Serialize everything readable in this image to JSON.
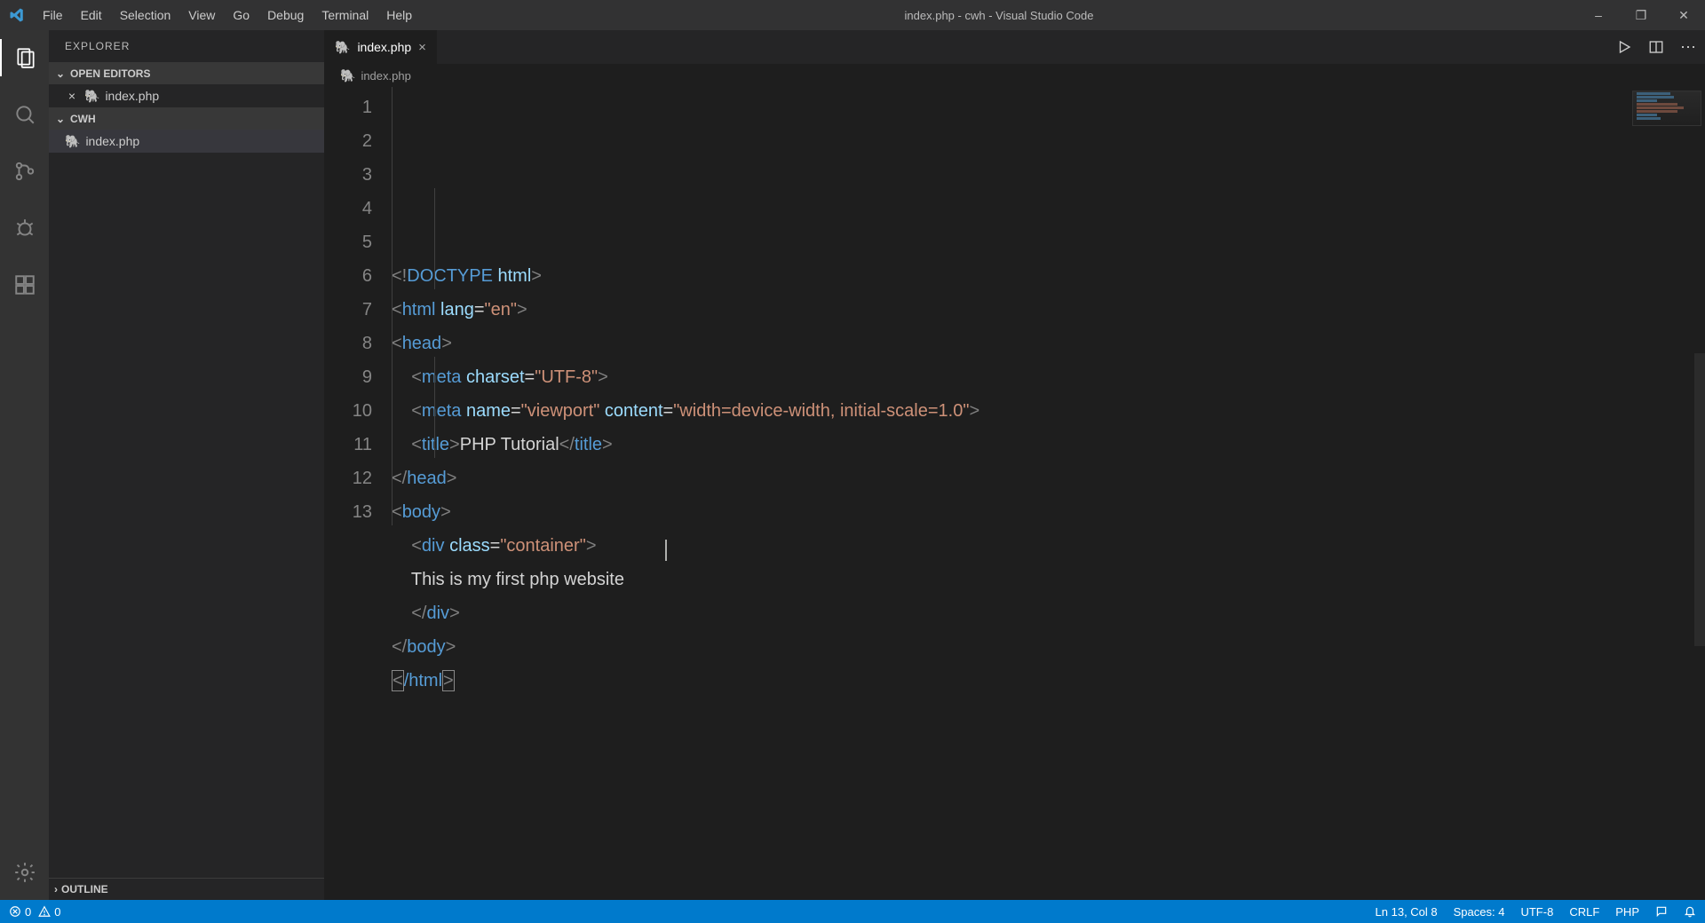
{
  "window": {
    "title": "index.php - cwh - Visual Studio Code"
  },
  "menus": [
    "File",
    "Edit",
    "Selection",
    "View",
    "Go",
    "Debug",
    "Terminal",
    "Help"
  ],
  "explorer": {
    "title": "EXPLORER",
    "open_editors_label": "OPEN EDITORS",
    "open_editors": [
      {
        "name": "index.php"
      }
    ],
    "folder_label": "CWH",
    "files": [
      {
        "name": "index.php"
      }
    ],
    "outline_label": "OUTLINE"
  },
  "tab": {
    "name": "index.php"
  },
  "breadcrumb": {
    "file": "index.php"
  },
  "code_lines": [
    {
      "n": "1",
      "tokens": [
        {
          "t": "<!",
          "c": "t-pun"
        },
        {
          "t": "DOCTYPE",
          "c": "t-doctype"
        },
        {
          "t": " ",
          "c": "t-txt"
        },
        {
          "t": "html",
          "c": "t-attr"
        },
        {
          "t": ">",
          "c": "t-pun"
        }
      ]
    },
    {
      "n": "2",
      "tokens": [
        {
          "t": "<",
          "c": "t-pun"
        },
        {
          "t": "html",
          "c": "t-tag"
        },
        {
          "t": " ",
          "c": ""
        },
        {
          "t": "lang",
          "c": "t-attr"
        },
        {
          "t": "=",
          "c": "t-txt"
        },
        {
          "t": "\"en\"",
          "c": "t-str"
        },
        {
          "t": ">",
          "c": "t-pun"
        }
      ]
    },
    {
      "n": "3",
      "tokens": [
        {
          "t": "<",
          "c": "t-pun"
        },
        {
          "t": "head",
          "c": "t-tag"
        },
        {
          "t": ">",
          "c": "t-pun"
        }
      ]
    },
    {
      "n": "4",
      "indent": "    ",
      "tokens": [
        {
          "t": "<",
          "c": "t-pun"
        },
        {
          "t": "meta",
          "c": "t-tag"
        },
        {
          "t": " ",
          "c": ""
        },
        {
          "t": "charset",
          "c": "t-attr"
        },
        {
          "t": "=",
          "c": "t-txt"
        },
        {
          "t": "\"UTF-8\"",
          "c": "t-str"
        },
        {
          "t": ">",
          "c": "t-pun"
        }
      ]
    },
    {
      "n": "5",
      "indent": "    ",
      "tokens": [
        {
          "t": "<",
          "c": "t-pun"
        },
        {
          "t": "meta",
          "c": "t-tag"
        },
        {
          "t": " ",
          "c": ""
        },
        {
          "t": "name",
          "c": "t-attr"
        },
        {
          "t": "=",
          "c": "t-txt"
        },
        {
          "t": "\"viewport\"",
          "c": "t-str"
        },
        {
          "t": " ",
          "c": ""
        },
        {
          "t": "content",
          "c": "t-attr"
        },
        {
          "t": "=",
          "c": "t-txt"
        },
        {
          "t": "\"width=device-width, initial-scale=1.0\"",
          "c": "t-str"
        },
        {
          "t": ">",
          "c": "t-pun"
        }
      ]
    },
    {
      "n": "6",
      "indent": "    ",
      "tokens": [
        {
          "t": "<",
          "c": "t-pun"
        },
        {
          "t": "title",
          "c": "t-tag"
        },
        {
          "t": ">",
          "c": "t-pun"
        },
        {
          "t": "PHP Tutorial",
          "c": "t-txt"
        },
        {
          "t": "</",
          "c": "t-pun"
        },
        {
          "t": "title",
          "c": "t-tag"
        },
        {
          "t": ">",
          "c": "t-pun"
        }
      ]
    },
    {
      "n": "7",
      "tokens": [
        {
          "t": "</",
          "c": "t-pun"
        },
        {
          "t": "head",
          "c": "t-tag"
        },
        {
          "t": ">",
          "c": "t-pun"
        }
      ]
    },
    {
      "n": "8",
      "tokens": [
        {
          "t": "<",
          "c": "t-pun"
        },
        {
          "t": "body",
          "c": "t-tag"
        },
        {
          "t": ">",
          "c": "t-pun"
        }
      ]
    },
    {
      "n": "9",
      "indent": "    ",
      "tokens": [
        {
          "t": "<",
          "c": "t-pun"
        },
        {
          "t": "div",
          "c": "t-tag"
        },
        {
          "t": " ",
          "c": ""
        },
        {
          "t": "class",
          "c": "t-attr"
        },
        {
          "t": "=",
          "c": "t-txt"
        },
        {
          "t": "\"container\"",
          "c": "t-str"
        },
        {
          "t": ">",
          "c": "t-pun"
        }
      ]
    },
    {
      "n": "10",
      "indent": "    ",
      "tokens": [
        {
          "t": "This is my first php website",
          "c": "t-txt"
        }
      ]
    },
    {
      "n": "11",
      "indent": "    ",
      "tokens": [
        {
          "t": "</",
          "c": "t-pun"
        },
        {
          "t": "div",
          "c": "t-tag"
        },
        {
          "t": ">",
          "c": "t-pun"
        }
      ]
    },
    {
      "n": "12",
      "tokens": [
        {
          "t": "</",
          "c": "t-pun"
        },
        {
          "t": "body",
          "c": "t-tag"
        },
        {
          "t": ">",
          "c": "t-pun"
        }
      ]
    },
    {
      "n": "13",
      "boxed": true,
      "tokens": [
        {
          "t": "<",
          "c": "t-pun"
        },
        {
          "t": "/html",
          "c": "t-tag"
        },
        {
          "t": ">",
          "c": "t-pun"
        }
      ]
    }
  ],
  "status": {
    "errors": "0",
    "warnings": "0",
    "ln_col": "Ln 13, Col 8",
    "spaces": "Spaces: 4",
    "encoding": "UTF-8",
    "eol": "CRLF",
    "lang": "PHP"
  }
}
